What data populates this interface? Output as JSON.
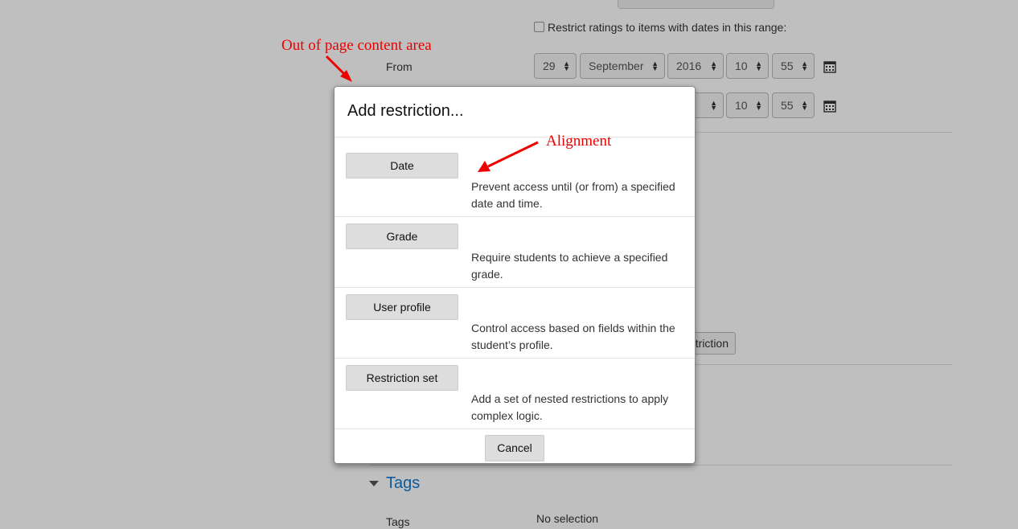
{
  "form": {
    "restrict_ratings_label": "Restrict ratings to items with dates in this range:",
    "from_label": "From",
    "date_row_1": {
      "day": "29",
      "month": "September",
      "year": "2016",
      "hour": "10",
      "minute": "55"
    },
    "date_row_2": {
      "year_partial": "6",
      "hour": "10",
      "minute": "55"
    },
    "add_restriction_partial": "triction",
    "tags_section_title": "Tags",
    "tags_label": "Tags",
    "tags_value": "No selection"
  },
  "modal": {
    "title": "Add restriction...",
    "options": [
      {
        "button": "Date",
        "description": "Prevent access until (or from) a specified date and time."
      },
      {
        "button": "Grade",
        "description": "Require students to achieve a specified grade."
      },
      {
        "button": "User profile",
        "description": "Control access based on fields within the student’s profile."
      },
      {
        "button": "Restriction set",
        "description": "Add a set of nested restrictions to apply complex logic."
      }
    ],
    "cancel": "Cancel"
  },
  "annotations": {
    "out_of_area": "Out of page content area",
    "alignment": "Alignment",
    "color": "#e00000"
  },
  "colors": {
    "link_blue": "#1177d1",
    "overlay": "#000000"
  }
}
